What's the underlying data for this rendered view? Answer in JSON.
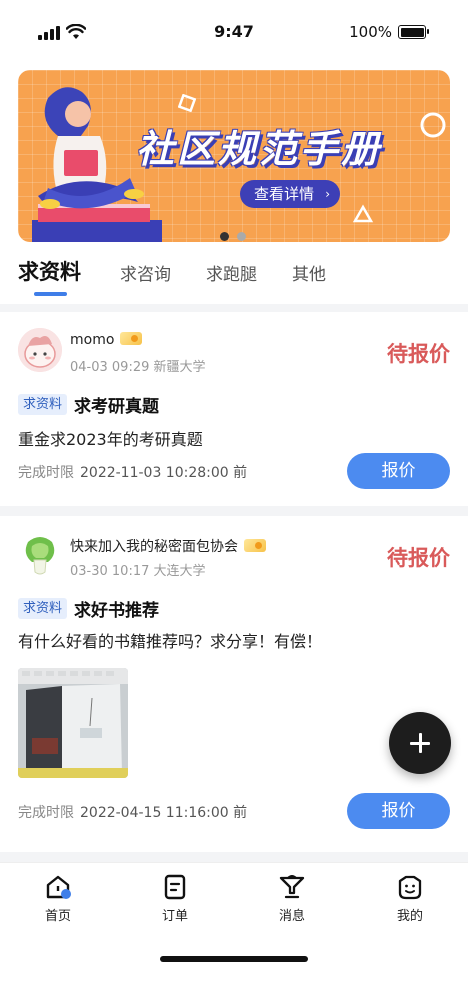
{
  "status_bar": {
    "time": "9:47",
    "battery_text": "100%"
  },
  "banner": {
    "title": "社区规范手册",
    "button_label": "查看详情",
    "arrow": "›",
    "colors": {
      "background": "#f7a24f",
      "accent": "#3d3fb6"
    }
  },
  "tabs": [
    {
      "label": "求资料",
      "active": true
    },
    {
      "label": "求咨询",
      "active": false
    },
    {
      "label": "求跑腿",
      "active": false
    },
    {
      "label": "其他",
      "active": false
    }
  ],
  "posts": [
    {
      "username": "momo",
      "time": "04-03 09:29",
      "school": "新疆大学",
      "status": "待报价",
      "tag": "求资料",
      "title": "求考研真题",
      "description": "重金求2023年的考研真题",
      "deadline_label": "完成时限",
      "deadline_value": "2022-11-03 10:28:00 前",
      "button_label": "报价"
    },
    {
      "username": "快来加入我的秘密面包协会",
      "time": "03-30 10:17",
      "school": "大连大学",
      "status": "待报价",
      "tag": "求资料",
      "title": "求好书推荐",
      "description": "有什么好看的书籍推荐吗？求分享！有偿！",
      "deadline_label": "完成时限",
      "deadline_value": "2022-04-15 11:16:00 前",
      "button_label": "报价"
    }
  ],
  "bottom_nav": [
    {
      "label": "首页",
      "icon": "home-icon",
      "active": true
    },
    {
      "label": "订单",
      "icon": "order-icon",
      "active": false
    },
    {
      "label": "消息",
      "icon": "message-icon",
      "active": false
    },
    {
      "label": "我的",
      "icon": "profile-icon",
      "active": false
    }
  ],
  "colors": {
    "status_red": "#d95a5a",
    "primary_blue": "#4c8bf0",
    "tag_bg": "#e6eefc"
  }
}
